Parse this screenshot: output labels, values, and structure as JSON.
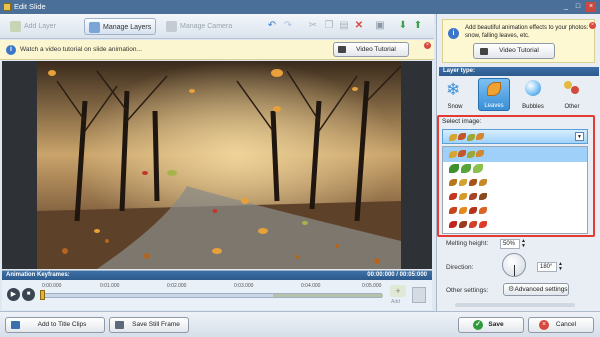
{
  "window": {
    "title": "Edit Slide"
  },
  "toolbar": {
    "add_layer": "Add Layer",
    "manage_layers": "Manage Layers",
    "manage_camera": "Manage Camera"
  },
  "hint": {
    "text": "Watch a video tutorial on slide animation...",
    "button": "Video Tutorial"
  },
  "keyframes": {
    "title": "Animation Keyframes:",
    "time": "00:00:000 / 00:05:000",
    "ticks": [
      "0:00.000",
      "0:01.000",
      "0:02.000",
      "0:03.000",
      "0:04.000",
      "0:05.000"
    ],
    "add_label": "Add"
  },
  "right_panel": {
    "promo_text": "Add beautiful animation effects to your photos: snow, falling leaves, etc.",
    "promo_button": "Video Tutorial",
    "layer_type_title": "Layer type:",
    "layer_types": [
      {
        "label": "Snow",
        "icon": "snowflake-icon"
      },
      {
        "label": "Leaves",
        "icon": "leaf-icon"
      },
      {
        "label": "Bubbles",
        "icon": "bubble-icon"
      },
      {
        "label": "Other",
        "icon": "other-icon"
      }
    ],
    "select_image_label": "Select image:",
    "melting_height_label": "Melting height:",
    "melting_height_value": "50%",
    "direction_label": "Direction:",
    "direction_value": "180°",
    "other_settings_label": "Other settings:",
    "advanced_settings": "Advanced settings"
  },
  "bottom": {
    "add_title_clips": "Add to Title Clips",
    "save_still_frame": "Save Still Frame",
    "save": "Save",
    "cancel": "Cancel"
  },
  "colors": {
    "accent": "#3a8fd6",
    "selection": "#9ed0fa",
    "highlight_border": "#e53b35",
    "title_bar": "#4a6f99"
  }
}
